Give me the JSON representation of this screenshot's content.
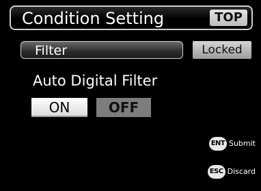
{
  "header": {
    "title": "Condition Setting",
    "top_button": "TOP"
  },
  "filter": {
    "label": "Filter",
    "status": "Locked"
  },
  "section": {
    "label": "Auto Digital Filter"
  },
  "options": {
    "on_label": "ON",
    "off_label": "OFF",
    "selected": "ON"
  },
  "keys": {
    "submit": {
      "icon": "ENT",
      "label": "Submit"
    },
    "discard": {
      "icon": "ESC",
      "label": "Discard"
    }
  }
}
